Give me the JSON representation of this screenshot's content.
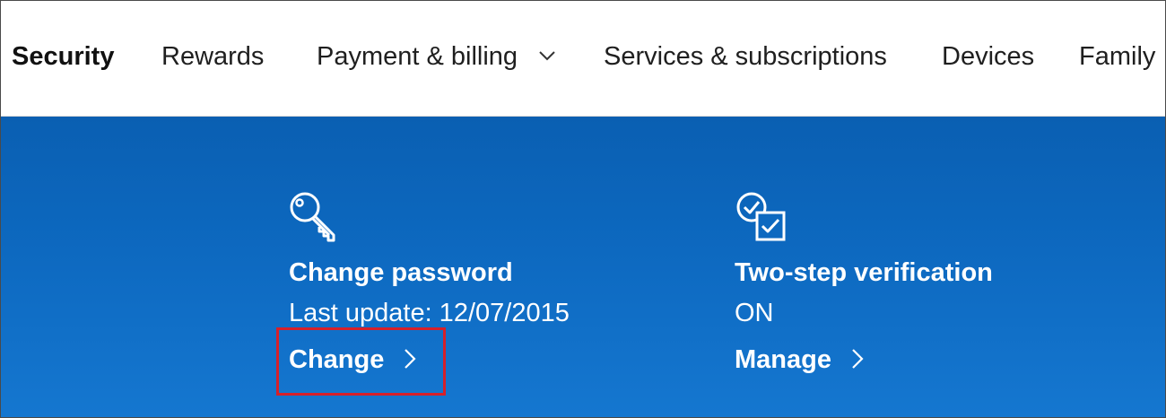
{
  "nav": {
    "items": [
      {
        "label": "Security",
        "active": true
      },
      {
        "label": "Rewards"
      },
      {
        "label": "Payment & billing",
        "has_dropdown": true
      },
      {
        "label": "Services & subscriptions"
      },
      {
        "label": "Devices"
      },
      {
        "label": "Family"
      }
    ],
    "dropdown_icon": "chevron-down-icon"
  },
  "panel": {
    "background_color": "#0d69c0",
    "cards": [
      {
        "icon": "key-icon",
        "title": "Change password",
        "subtitle": "Last update: 12/07/2015",
        "link": "Change",
        "link_icon": "chevron-right-icon",
        "highlighted": true
      },
      {
        "icon": "two-step-verification-icon",
        "title": "Two-step verification",
        "subtitle": "ON",
        "link": "Manage",
        "link_icon": "chevron-right-icon"
      }
    ]
  },
  "highlight_color": "#d6202a"
}
